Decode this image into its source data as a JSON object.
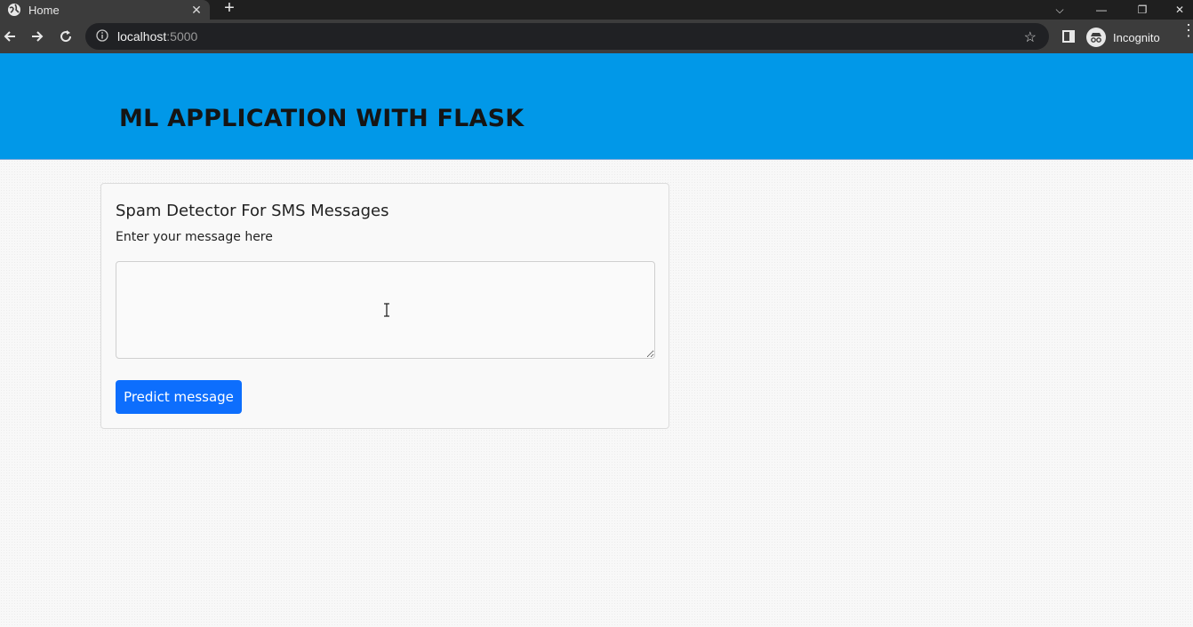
{
  "browser": {
    "tab_title": "Home",
    "tab_close": "✕",
    "new_tab": "+",
    "url_host": "localhost",
    "url_port": ":5000",
    "incognito_label": "Incognito",
    "window_controls": {
      "tab_search": "⌵",
      "minimize": "—",
      "restore": "❐",
      "close": "✕"
    },
    "star": "☆",
    "kebab": "⋮"
  },
  "header": {
    "title": "ML APPLICATION WITH FLASK",
    "background": "#0198e8"
  },
  "form": {
    "title": "Spam Detector For SMS Messages",
    "label": "Enter your message here",
    "message_value": "",
    "submit_label": "Predict message",
    "button_color": "#0d6efd"
  }
}
